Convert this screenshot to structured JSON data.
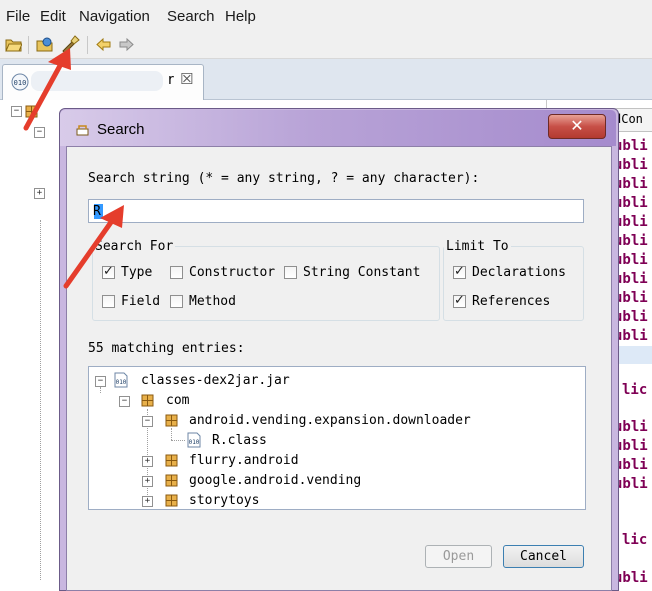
{
  "menu": [
    "File",
    "Edit",
    "Navigation",
    "Search",
    "Help"
  ],
  "toolbar_icons": [
    "open-folder-icon",
    "open-database-icon",
    "search-flashlight-icon",
    "back-arrow-icon",
    "forward-arrow-icon"
  ],
  "file_tab": {
    "label_visible": "r",
    "close_glyph": "☒",
    "icon_label": "010"
  },
  "right_code_keyword": "ubli",
  "right_code_keyword2": "lic",
  "right_header_fragment": "dCon",
  "dialog": {
    "title": "Search",
    "close_label": "✕",
    "search_label": "Search string (* = any string, ? = any character):",
    "search_value": "R",
    "search_for": {
      "legend": "Search For",
      "options": [
        {
          "label": "Type",
          "checked": true
        },
        {
          "label": "Constructor",
          "checked": false
        },
        {
          "label": "String Constant",
          "checked": false
        },
        {
          "label": "Field",
          "checked": false
        },
        {
          "label": "Method",
          "checked": false
        }
      ]
    },
    "limit_to": {
      "legend": "Limit To",
      "options": [
        {
          "label": "Declarations",
          "checked": true
        },
        {
          "label": "References",
          "checked": true
        }
      ]
    },
    "match_count_label": "55 matching entries:",
    "tree": {
      "root": "classes-dex2jar.jar",
      "com": "com",
      "pkg1": "android.vending.expansion.downloader",
      "class1": "R.class",
      "pkg2": "flurry.android",
      "pkg3": "google.android.vending",
      "pkg4": "storytoys",
      "jar_icon_label": "010"
    },
    "open_label": "Open",
    "cancel_label": "Cancel"
  },
  "colors": {
    "accent_red": "#e53d2c",
    "code_keyword": "#7f0055",
    "dialog_chrome": "#b8a3d7"
  }
}
